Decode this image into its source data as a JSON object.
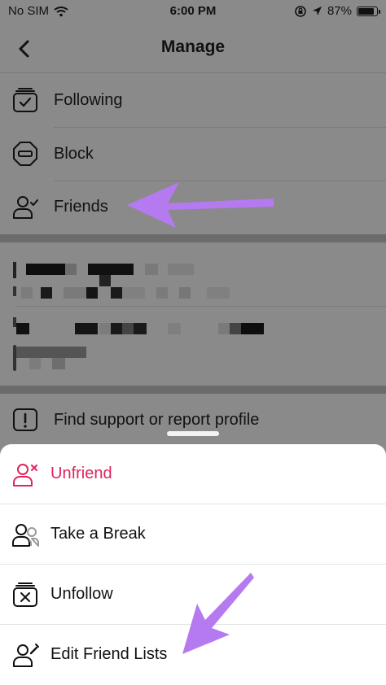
{
  "status_bar": {
    "carrier": "No SIM",
    "time": "6:00 PM",
    "battery": "87%",
    "battery_level": 0.87
  },
  "header": {
    "title": "Manage",
    "back_icon": "chevron-left-icon"
  },
  "manage_items": [
    {
      "label": "Following",
      "icon": "following-icon"
    },
    {
      "label": "Block",
      "icon": "block-icon"
    },
    {
      "label": "Friends",
      "icon": "friends-icon"
    }
  ],
  "support": {
    "label": "Find support or report profile",
    "icon": "exclamation-icon"
  },
  "sheet_items": [
    {
      "label": "Unfriend",
      "icon": "unfriend-icon",
      "color": "#e0245e"
    },
    {
      "label": "Take a Break",
      "icon": "take-break-icon"
    },
    {
      "label": "Unfollow",
      "icon": "unfollow-icon"
    },
    {
      "label": "Edit Friend Lists",
      "icon": "edit-friend-list-icon"
    }
  ],
  "colors": {
    "arrow": "#b57af0",
    "danger": "#e0245e",
    "overlay": "#8a8a8a"
  }
}
